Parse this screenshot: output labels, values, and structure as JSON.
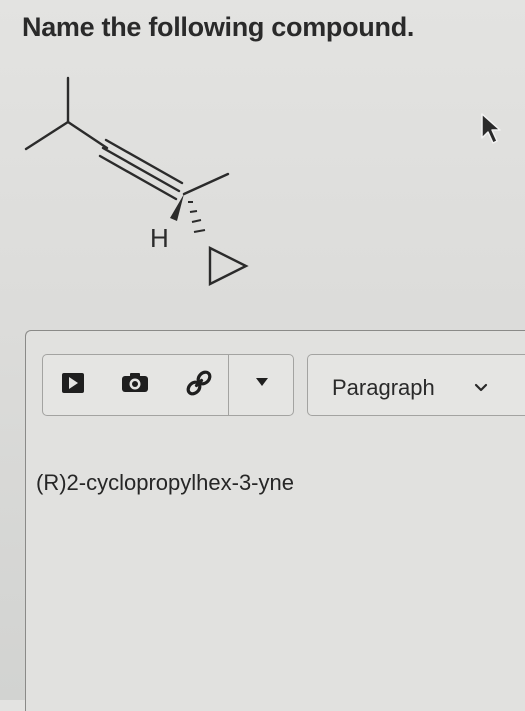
{
  "question": {
    "text": "Name the following compound."
  },
  "structure": {
    "h_label": "H"
  },
  "toolbar": {
    "media_icon": "media-play-icon",
    "camera_icon": "camera-icon",
    "link_icon": "link-icon",
    "dropdown_icon": "triangle-down-icon"
  },
  "format_select": {
    "selected": "Paragraph",
    "icon": "chevron-down-icon"
  },
  "editor": {
    "answer_text": "(R)2-cyclopropylhex-3-yne"
  }
}
